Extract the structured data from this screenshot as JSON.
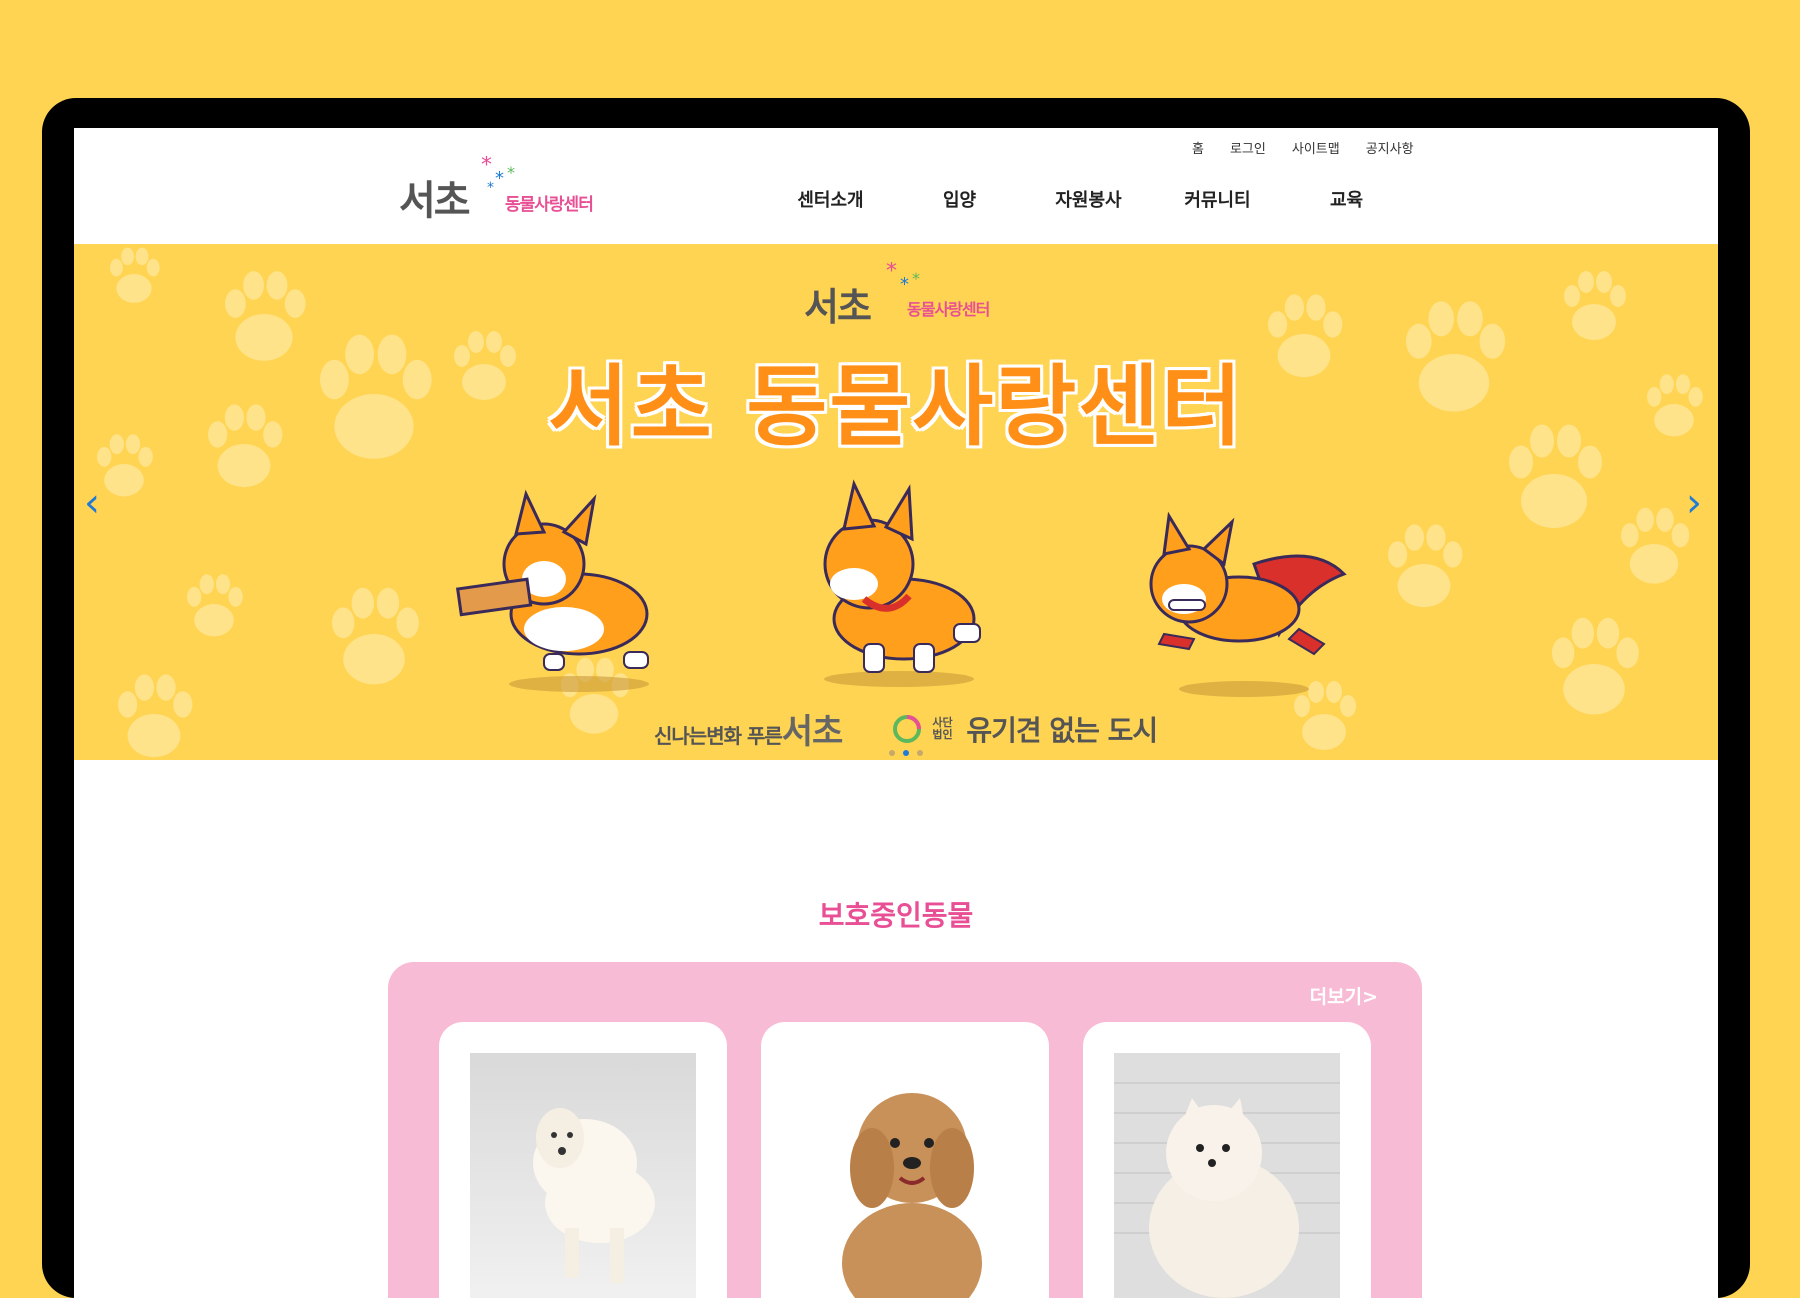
{
  "util_nav": [
    "홈",
    "로그인",
    "사이트맵",
    "공지사항"
  ],
  "logo": {
    "main": "서초",
    "sub": "동물사랑센터"
  },
  "main_nav": [
    "센터소개",
    "입양",
    "자원봉사",
    "커뮤니티",
    "교육"
  ],
  "banner": {
    "logo_main": "서초",
    "logo_sub": "동물사랑센터",
    "title": "서초 동물사랑센터",
    "footer_left_small": "신나는변화 푸른",
    "footer_left_big": "서초",
    "footer_right_small": "사단법인",
    "footer_right": "유기견 없는 도시",
    "prev_arrow": "‹",
    "next_arrow": "›",
    "slides": 3,
    "active_slide": 2
  },
  "section": {
    "title": "보호중인동물",
    "more": "더보기>",
    "animals": [
      {
        "image": "white-retriever-puppy"
      },
      {
        "image": "brown-poodle"
      },
      {
        "image": "white-pomeranian"
      }
    ]
  },
  "colors": {
    "background": "#ffd452",
    "accent_pink": "#e84f95",
    "box_pink": "#f8bbd5",
    "title_orange": "#ff8f17",
    "arrow_blue": "#1e7bd8"
  }
}
